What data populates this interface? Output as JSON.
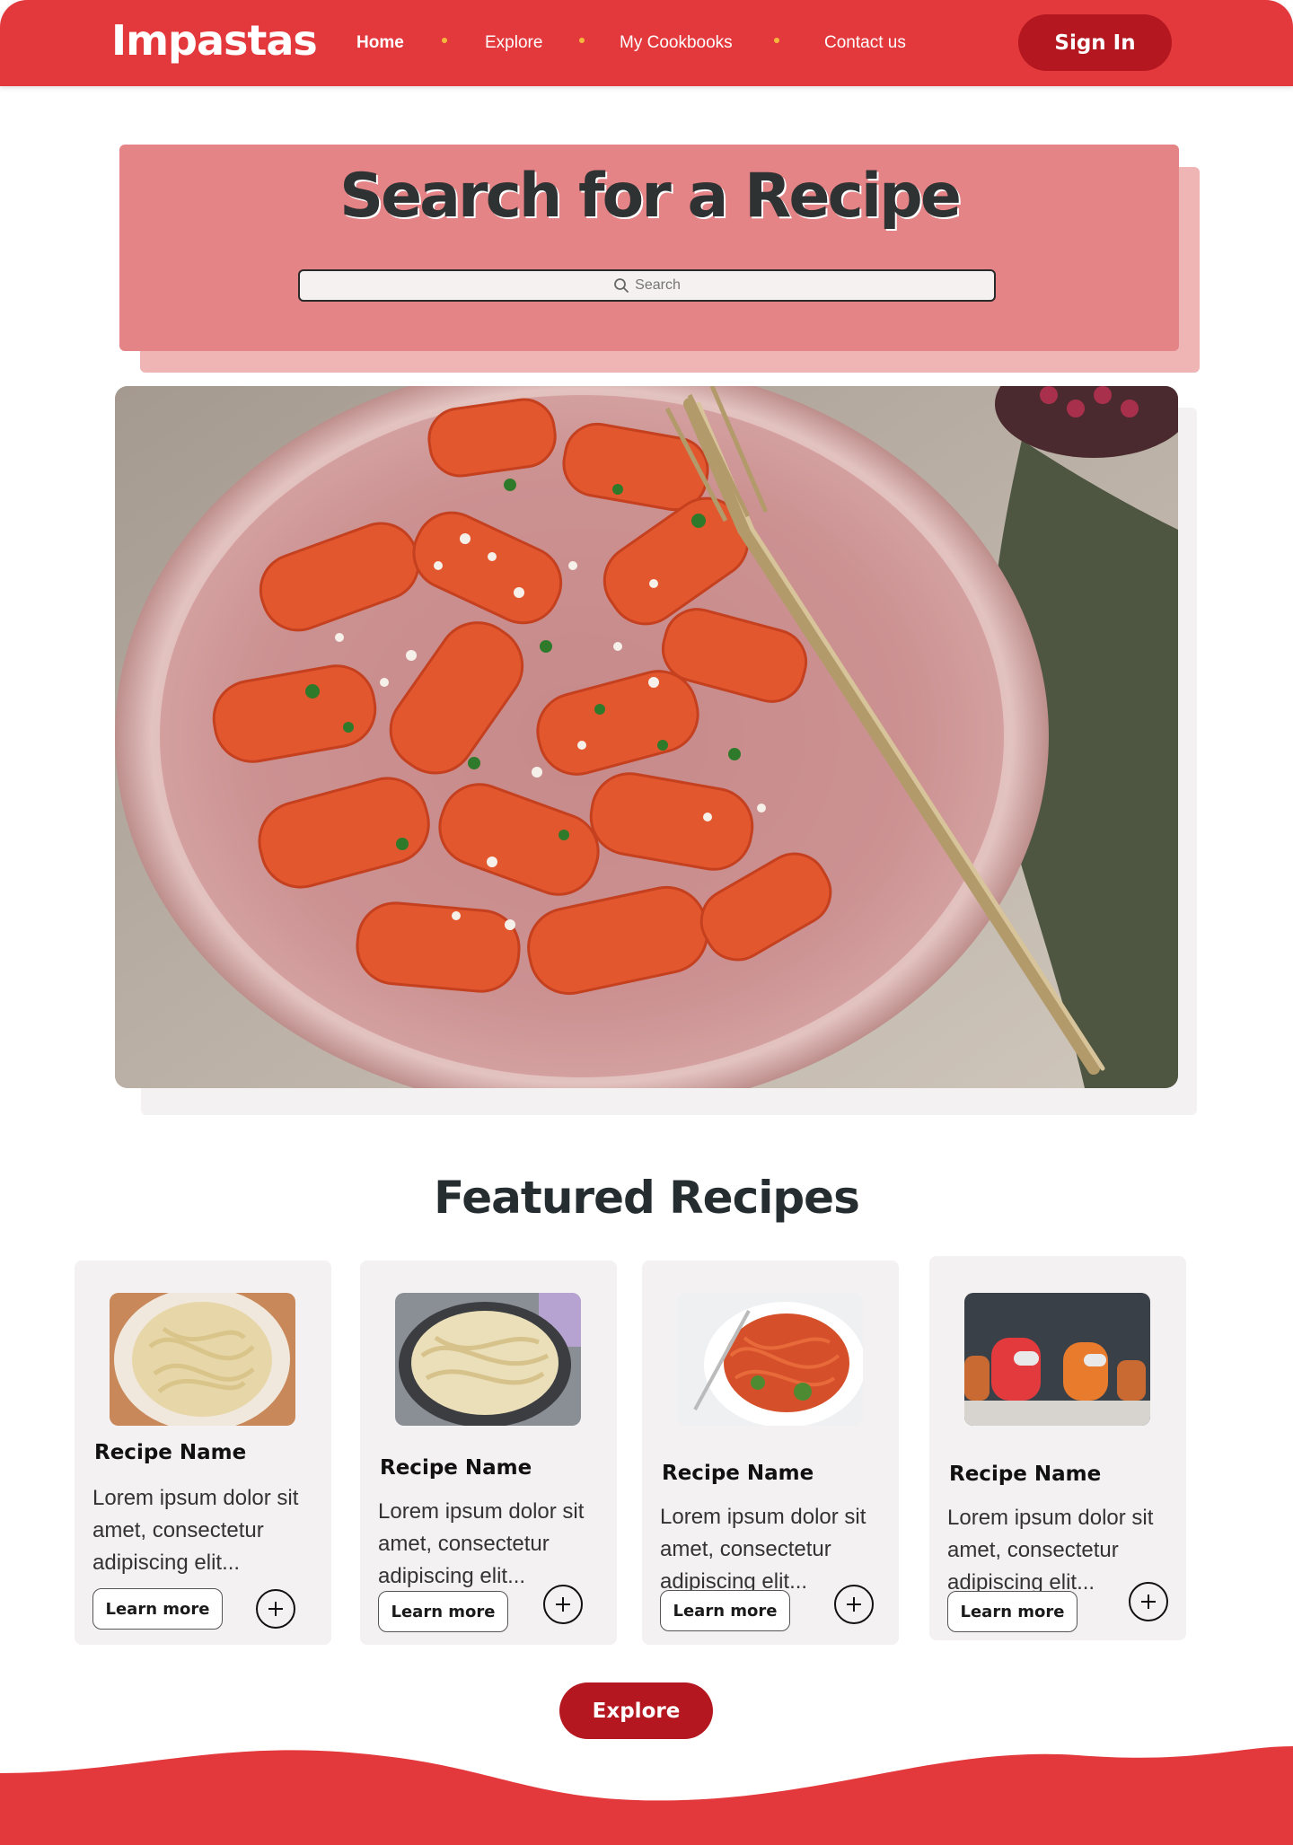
{
  "nav": {
    "brand": "Impastas",
    "links": [
      "Home",
      "Explore",
      "My Cookbooks",
      "Contact us"
    ],
    "active": "Home",
    "signin": "Sign In"
  },
  "search": {
    "title": "Search for a Recipe",
    "placeholder": "Search",
    "icon": "search-icon"
  },
  "hero": {
    "image": "rigatoni-pasta-bowl-photo"
  },
  "featured": {
    "title": "Featured Recipes",
    "cards": [
      {
        "name": "Recipe Name",
        "desc": "Lorem ipsum dolor sit amet, consectetur adipiscing elit...",
        "learn": "Learn more",
        "image": "fettuccine-alfredo-plate"
      },
      {
        "name": "Recipe Name",
        "desc": "Lorem ipsum dolor sit amet, consectetur adipiscing elit...",
        "learn": "Learn more",
        "image": "alfredo-pan"
      },
      {
        "name": "Recipe Name",
        "desc": "Lorem ipsum dolor sit amet, consectetur adipiscing elit...",
        "learn": "Learn more",
        "image": "spaghetti-tomato-basil"
      },
      {
        "name": "Recipe Name",
        "desc": "Lorem ipsum dolor sit amet, consectetur adipiscing elit...",
        "learn": "Learn more",
        "image": "among-us-cookies"
      }
    ],
    "explore": "Explore"
  },
  "colors": {
    "brand_red": "#e3393c",
    "dark_red": "#b4171f",
    "panel_pink": "#e58486",
    "card_bg": "#f3f1f1"
  }
}
